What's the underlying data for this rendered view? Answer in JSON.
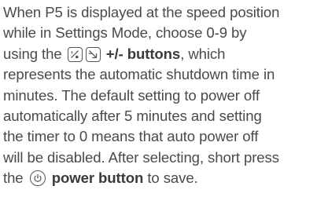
{
  "paragraph": {
    "line1": "When P5 is displayed at the speed position",
    "line2": "while in Settings Mode, choose 0-9 by",
    "line3_pre": "using the",
    "line3_bold": "+/- buttons",
    "line3_post": ", which",
    "line4": "represents the automatic shutdown time in",
    "line5": "minutes.  The default setting to power off",
    "line6": "automatically after 5 minutes and setting",
    "line7": "the timer to 0 means that auto power off",
    "line8": "will be disabled. After selecting, short press",
    "line9_pre": "the",
    "line9_bold": "power button",
    "line9_post": " to save."
  },
  "icons": {
    "plus_button": "plus-speed-icon",
    "minus_button": "minus-speed-icon",
    "power_button": "power-icon"
  }
}
